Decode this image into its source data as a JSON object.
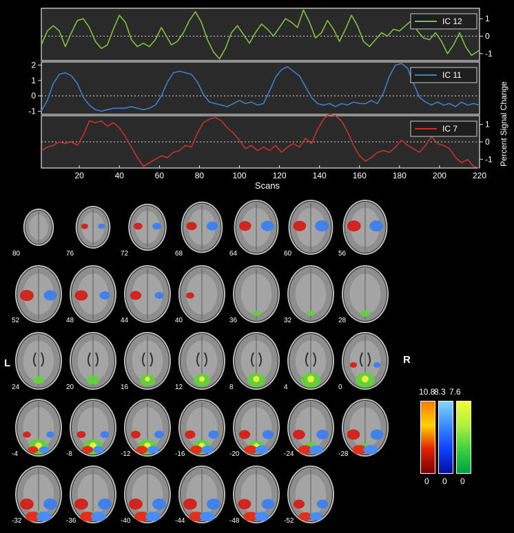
{
  "chart_data": {
    "type": "line",
    "xlabel": "Scans",
    "ylabel": "Percent Signal Change",
    "x_ticks": [
      20,
      40,
      60,
      80,
      100,
      120,
      140,
      160,
      180,
      200,
      220
    ],
    "xlim": [
      1,
      220
    ],
    "grid": false,
    "legend": "top-right",
    "panels": [
      {
        "name": "IC 12",
        "color": "#7fc241",
        "ylim": [
          -1.4,
          1.6
        ],
        "y_ticks": [
          1,
          0,
          -1
        ],
        "y_tick_labels": [
          "1",
          "0",
          "-1"
        ],
        "tick_side": "right",
        "points": [
          [
            1,
            -0.5
          ],
          [
            4,
            0.3
          ],
          [
            7,
            0.6
          ],
          [
            10,
            0.3
          ],
          [
            13,
            -0.6
          ],
          [
            16,
            0.2
          ],
          [
            19,
            0.9
          ],
          [
            22,
            1.0
          ],
          [
            25,
            0.5
          ],
          [
            28,
            -0.3
          ],
          [
            31,
            -0.7
          ],
          [
            34,
            -0.5
          ],
          [
            37,
            0.4
          ],
          [
            40,
            1.2
          ],
          [
            43,
            0.8
          ],
          [
            46,
            -0.2
          ],
          [
            49,
            -0.6
          ],
          [
            52,
            -0.4
          ],
          [
            55,
            -0.6
          ],
          [
            58,
            -0.2
          ],
          [
            61,
            0.5
          ],
          [
            63,
            0.1
          ],
          [
            66,
            -0.5
          ],
          [
            69,
            -0.3
          ],
          [
            72,
            0.2
          ],
          [
            75,
            0.9
          ],
          [
            78,
            1.4
          ],
          [
            81,
            0.8
          ],
          [
            84,
            -0.2
          ],
          [
            87,
            -0.9
          ],
          [
            90,
            -1.3
          ],
          [
            93,
            -0.7
          ],
          [
            96,
            0.2
          ],
          [
            99,
            0.6
          ],
          [
            102,
            0.1
          ],
          [
            105,
            -0.4
          ],
          [
            108,
            0.2
          ],
          [
            111,
            0.7
          ],
          [
            114,
            0.4
          ],
          [
            117,
            0.0
          ],
          [
            120,
            0.5
          ],
          [
            123,
            1.0
          ],
          [
            126,
            0.8
          ],
          [
            129,
            0.5
          ],
          [
            132,
            1.5
          ],
          [
            135,
            0.8
          ],
          [
            138,
            -0.1
          ],
          [
            141,
            0.2
          ],
          [
            144,
            0.9
          ],
          [
            147,
            0.4
          ],
          [
            150,
            -0.3
          ],
          [
            153,
            0.4
          ],
          [
            156,
            1.2
          ],
          [
            159,
            0.6
          ],
          [
            162,
            -0.3
          ],
          [
            165,
            -0.6
          ],
          [
            168,
            -0.2
          ],
          [
            171,
            0.2
          ],
          [
            174,
            0.0
          ],
          [
            177,
            0.4
          ],
          [
            180,
            0.3
          ],
          [
            183,
            0.6
          ],
          [
            186,
            0.9
          ],
          [
            189,
            0.3
          ],
          [
            192,
            -0.1
          ],
          [
            195,
            -0.2
          ],
          [
            198,
            0.2
          ],
          [
            201,
            -0.3
          ],
          [
            204,
            -1.0
          ],
          [
            207,
            -0.5
          ],
          [
            210,
            0.2
          ],
          [
            213,
            -0.6
          ],
          [
            216,
            -1.1
          ],
          [
            220,
            -0.8
          ]
        ]
      },
      {
        "name": "IC 11",
        "color": "#3f7fcc",
        "ylim": [
          -1.2,
          2.2
        ],
        "y_ticks": [
          2,
          1,
          0,
          -1
        ],
        "y_tick_labels": [
          "2",
          "1",
          "0",
          "-1"
        ],
        "tick_side": "left",
        "points": [
          [
            1,
            -1.0
          ],
          [
            4,
            -0.3
          ],
          [
            7,
            0.8
          ],
          [
            10,
            1.4
          ],
          [
            13,
            1.5
          ],
          [
            16,
            1.3
          ],
          [
            19,
            0.8
          ],
          [
            22,
            -0.1
          ],
          [
            25,
            -0.6
          ],
          [
            28,
            -0.9
          ],
          [
            31,
            -1.0
          ],
          [
            34,
            -0.9
          ],
          [
            37,
            -0.8
          ],
          [
            40,
            -0.8
          ],
          [
            43,
            -0.8
          ],
          [
            46,
            -0.7
          ],
          [
            49,
            -0.8
          ],
          [
            52,
            -0.9
          ],
          [
            55,
            -0.8
          ],
          [
            58,
            -0.6
          ],
          [
            61,
            0.0
          ],
          [
            64,
            0.9
          ],
          [
            67,
            1.5
          ],
          [
            70,
            1.6
          ],
          [
            73,
            1.5
          ],
          [
            76,
            1.4
          ],
          [
            79,
            0.9
          ],
          [
            82,
            0.1
          ],
          [
            85,
            -0.4
          ],
          [
            88,
            -0.5
          ],
          [
            91,
            -0.6
          ],
          [
            94,
            -0.7
          ],
          [
            97,
            -0.5
          ],
          [
            100,
            -0.3
          ],
          [
            103,
            -0.5
          ],
          [
            106,
            -0.4
          ],
          [
            109,
            -0.6
          ],
          [
            112,
            -0.5
          ],
          [
            115,
            0.3
          ],
          [
            118,
            1.2
          ],
          [
            121,
            1.7
          ],
          [
            124,
            1.9
          ],
          [
            127,
            1.6
          ],
          [
            130,
            1.3
          ],
          [
            133,
            0.6
          ],
          [
            136,
            -0.1
          ],
          [
            139,
            -0.5
          ],
          [
            142,
            -0.6
          ],
          [
            145,
            -0.5
          ],
          [
            148,
            -0.7
          ],
          [
            151,
            -0.5
          ],
          [
            154,
            -0.6
          ],
          [
            157,
            -0.4
          ],
          [
            160,
            -0.5
          ],
          [
            163,
            -0.5
          ],
          [
            166,
            -0.3
          ],
          [
            169,
            -0.5
          ],
          [
            172,
            0.2
          ],
          [
            175,
            1.3
          ],
          [
            178,
            2.0
          ],
          [
            181,
            2.1
          ],
          [
            184,
            1.8
          ],
          [
            187,
            0.8
          ],
          [
            190,
            -0.1
          ],
          [
            193,
            -0.4
          ],
          [
            196,
            -0.6
          ],
          [
            199,
            -0.4
          ],
          [
            202,
            -0.6
          ],
          [
            205,
            -0.5
          ],
          [
            208,
            -0.7
          ],
          [
            211,
            -0.4
          ],
          [
            214,
            -0.6
          ],
          [
            217,
            -0.5
          ],
          [
            220,
            -0.6
          ]
        ]
      },
      {
        "name": "IC 7",
        "color": "#c8322b",
        "ylim": [
          -1.5,
          1.5
        ],
        "y_ticks": [
          1,
          0,
          -1
        ],
        "y_tick_labels": [
          "1",
          "0",
          "-1"
        ],
        "tick_side": "right",
        "points": [
          [
            1,
            -0.5
          ],
          [
            4,
            -0.3
          ],
          [
            7,
            -0.2
          ],
          [
            10,
            0.0
          ],
          [
            13,
            -0.1
          ],
          [
            16,
            0.0
          ],
          [
            19,
            -0.2
          ],
          [
            22,
            0.4
          ],
          [
            25,
            1.2
          ],
          [
            28,
            1.1
          ],
          [
            31,
            1.2
          ],
          [
            34,
            0.9
          ],
          [
            37,
            1.1
          ],
          [
            40,
            0.8
          ],
          [
            43,
            0.3
          ],
          [
            46,
            -0.3
          ],
          [
            49,
            -0.9
          ],
          [
            52,
            -1.4
          ],
          [
            55,
            -1.2
          ],
          [
            58,
            -1.0
          ],
          [
            61,
            -0.8
          ],
          [
            64,
            -0.9
          ],
          [
            67,
            -0.6
          ],
          [
            70,
            -0.5
          ],
          [
            73,
            -0.2
          ],
          [
            76,
            -0.3
          ],
          [
            79,
            0.5
          ],
          [
            82,
            1.1
          ],
          [
            85,
            1.3
          ],
          [
            88,
            1.4
          ],
          [
            91,
            1.2
          ],
          [
            94,
            0.8
          ],
          [
            97,
            0.5
          ],
          [
            100,
            0.1
          ],
          [
            103,
            -0.4
          ],
          [
            106,
            -0.2
          ],
          [
            109,
            -0.5
          ],
          [
            112,
            -0.3
          ],
          [
            115,
            -0.5
          ],
          [
            118,
            -0.2
          ],
          [
            121,
            -0.6
          ],
          [
            124,
            -0.3
          ],
          [
            127,
            -0.1
          ],
          [
            130,
            -0.3
          ],
          [
            133,
            0.2
          ],
          [
            136,
            -0.1
          ],
          [
            139,
            0.7
          ],
          [
            142,
            1.3
          ],
          [
            145,
            1.6
          ],
          [
            148,
            1.5
          ],
          [
            151,
            1.2
          ],
          [
            154,
            0.6
          ],
          [
            157,
            -0.2
          ],
          [
            160,
            -0.8
          ],
          [
            163,
            -1.1
          ],
          [
            166,
            -0.9
          ],
          [
            169,
            -0.6
          ],
          [
            172,
            -0.5
          ],
          [
            175,
            -0.6
          ],
          [
            178,
            -0.3
          ],
          [
            181,
            0.1
          ],
          [
            184,
            -0.2
          ],
          [
            187,
            -0.4
          ],
          [
            190,
            -0.6
          ],
          [
            193,
            -0.2
          ],
          [
            196,
            0.3
          ],
          [
            199,
            -0.1
          ],
          [
            202,
            -0.2
          ],
          [
            205,
            -0.4
          ],
          [
            208,
            -0.9
          ],
          [
            211,
            -1.2
          ],
          [
            214,
            -1.0
          ],
          [
            217,
            -1.4
          ],
          [
            220,
            -1.5
          ]
        ]
      }
    ]
  },
  "brain_slices": {
    "rows": [
      [
        {
          "z": "80",
          "act": {
            "red": 0,
            "blue": 0,
            "green": 0
          }
        },
        {
          "z": "76",
          "act": {
            "red": 0.2,
            "blue": 0.2,
            "green": 0
          }
        },
        {
          "z": "72",
          "act": {
            "red": 0.4,
            "blue": 0.4,
            "green": 0
          }
        },
        {
          "z": "68",
          "act": {
            "red": 0.6,
            "blue": 0.7,
            "green": 0
          }
        },
        {
          "z": "64",
          "act": {
            "red": 0.8,
            "blue": 0.9,
            "green": 0
          }
        },
        {
          "z": "60",
          "act": {
            "red": 0.9,
            "blue": 1,
            "green": 0
          }
        },
        {
          "z": "56",
          "act": {
            "red": 1,
            "blue": 1,
            "green": 0
          }
        }
      ],
      [
        {
          "z": "52",
          "act": {
            "red": 1,
            "blue": 0.9,
            "green": 0
          }
        },
        {
          "z": "48",
          "act": {
            "red": 0.9,
            "blue": 0.6,
            "green": 0
          }
        },
        {
          "z": "44",
          "act": {
            "red": 0.7,
            "blue": 0.4,
            "green": 0
          }
        },
        {
          "z": "40",
          "act": {
            "red": 0.3,
            "blue": 0,
            "green": 0
          }
        },
        {
          "z": "36",
          "act": {
            "red": 0,
            "blue": 0,
            "green": 0.2
          }
        },
        {
          "z": "32",
          "act": {
            "red": 0,
            "blue": 0,
            "green": 0.2
          }
        },
        {
          "z": "28",
          "act": {
            "red": 0,
            "blue": 0,
            "green": 0.3
          }
        }
      ],
      [
        {
          "z": "24",
          "act": {
            "red": 0,
            "blue": 0,
            "green": 0.4
          }
        },
        {
          "z": "20",
          "act": {
            "red": 0,
            "blue": 0,
            "green": 0.5
          }
        },
        {
          "z": "16",
          "act": {
            "red": 0,
            "blue": 0,
            "green": 0.7
          }
        },
        {
          "z": "12",
          "act": {
            "red": 0,
            "blue": 0,
            "green": 0.8
          }
        },
        {
          "z": "8",
          "act": {
            "red": 0,
            "blue": 0,
            "green": 0.9
          }
        },
        {
          "z": "4",
          "act": {
            "red": 0,
            "blue": 0,
            "green": 1
          }
        },
        {
          "z": "0",
          "act": {
            "red": 0.2,
            "blue": 0.2,
            "green": 1
          }
        }
      ],
      [
        {
          "z": "-4",
          "act": {
            "red": 0.3,
            "blue": 0.3,
            "green": 1
          }
        },
        {
          "z": "-8",
          "act": {
            "red": 0.4,
            "blue": 0.4,
            "green": 1
          }
        },
        {
          "z": "-12",
          "act": {
            "red": 0.5,
            "blue": 0.5,
            "green": 1
          }
        },
        {
          "z": "-16",
          "act": {
            "red": 0.6,
            "blue": 0.6,
            "green": 0.9
          }
        },
        {
          "z": "-20",
          "act": {
            "red": 0.7,
            "blue": 0.7,
            "green": 0.8
          }
        },
        {
          "z": "-24",
          "act": {
            "red": 0.8,
            "blue": 0.8,
            "green": 0.6
          }
        },
        {
          "z": "-28",
          "act": {
            "red": 0.9,
            "blue": 0.9,
            "green": 0.4
          }
        }
      ],
      [
        {
          "z": "-32",
          "act": {
            "red": 1,
            "blue": 1,
            "green": 0.3
          }
        },
        {
          "z": "-36",
          "act": {
            "red": 1,
            "blue": 1,
            "green": 0.2
          }
        },
        {
          "z": "-40",
          "act": {
            "red": 1,
            "blue": 1,
            "green": 0.1
          }
        },
        {
          "z": "-44",
          "act": {
            "red": 1,
            "blue": 1,
            "green": 0
          }
        },
        {
          "z": "-48",
          "act": {
            "red": 0.9,
            "blue": 0.9,
            "green": 0
          }
        },
        {
          "z": "-52",
          "act": {
            "red": 0.7,
            "blue": 0.7,
            "green": 0
          }
        }
      ]
    ],
    "left_label": "L",
    "right_label": "R"
  },
  "colorbars": {
    "top_labels": [
      "10.8",
      "8.3",
      "7.6"
    ],
    "bottom_labels": [
      "0",
      "0",
      "0"
    ],
    "gradients": [
      [
        "#ff7a00",
        "#ffd200",
        "#e02000",
        "#7a0000"
      ],
      [
        "#7fd8ff",
        "#3a8cff",
        "#1040ff",
        "#0010a0"
      ],
      [
        "#f0ff30",
        "#b0f040",
        "#40d040",
        "#00a040"
      ]
    ]
  }
}
